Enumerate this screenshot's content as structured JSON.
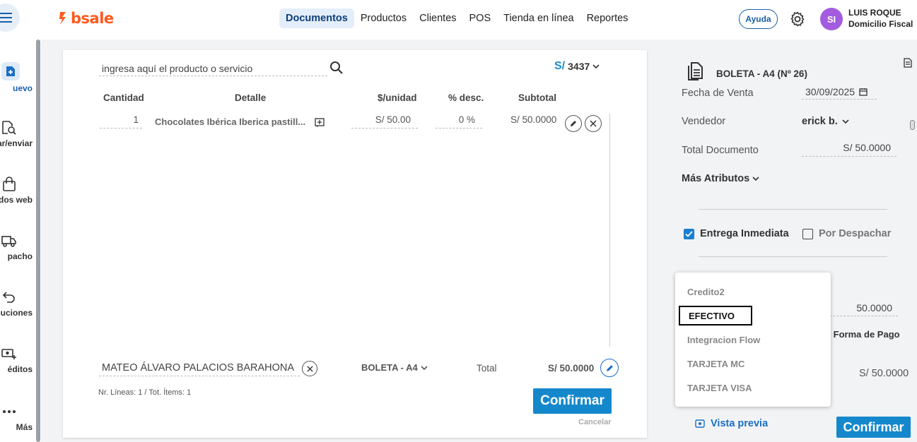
{
  "header": {
    "logo_text": "bsale",
    "nav": [
      "Documentos",
      "Productos",
      "Clientes",
      "POS",
      "Tienda en línea",
      "Reportes"
    ],
    "help_label": "Ayuda",
    "avatar_initials": "SI",
    "user_name": "LUIS ROQUE",
    "user_branch": "Domicilio Fiscal"
  },
  "sidebar": {
    "items": [
      {
        "label": "uevo",
        "icon": "new-document-icon"
      },
      {
        "label": "ar/enviar",
        "icon": "search-document-icon"
      },
      {
        "label": "dos web",
        "icon": "shopping-bag-icon"
      },
      {
        "label": "pacho",
        "icon": "truck-icon"
      },
      {
        "label": "luciones",
        "icon": "return-arrow-icon"
      },
      {
        "label": "éditos",
        "icon": "cash-plus-icon"
      },
      {
        "label": "Más",
        "icon": "more-dots-icon"
      }
    ]
  },
  "document": {
    "search_placeholder": "ingresa aquí el producto o servicio",
    "price_list_currency": "S/",
    "price_list_number": "3437",
    "columns": [
      "Cantidad",
      "Detalle",
      "$/unidad",
      "% desc.",
      "Subtotal"
    ],
    "rows": [
      {
        "quantity": "1",
        "detail": "Chocolates Ibérica Iberica pastill...",
        "unit_price": "S/ 50.00",
        "discount": "0 %",
        "subtotal": "S/ 50.0000"
      }
    ],
    "client": "MATEO ÁLVARO PALACIOS BARAHONA",
    "doc_type": "BOLETA - A4",
    "total_label": "Total",
    "total_value": "S/ 50.0000",
    "lines_info": "Nr. Líneas: 1 / Tot. Ítems: 1",
    "confirm_label": "Confirmar",
    "cancel_label": "Cancelar"
  },
  "side_panel": {
    "doc_title": "BOLETA - A4 (Nº 26)",
    "sale_date_label": "Fecha de Venta",
    "sale_date": "30/09/2025",
    "seller_label": "Vendedor",
    "seller": "erick b.",
    "total_doc_label": "Total Documento",
    "total_doc": "S/ 50.0000",
    "more_attrs": "Más Atributos",
    "delivery_now": "Entrega Inmediata",
    "delivery_now_checked": true,
    "to_dispatch": "Por Despachar",
    "to_dispatch_checked": false,
    "payment_amount": "50.0000",
    "payment_link_partial": "r Forma de Pago",
    "payment_total": "S/ 50.0000",
    "preview_label": "Vista previa",
    "confirm_label": "Confirmar"
  },
  "payment_dropdown": {
    "options": [
      "Credito2",
      "EFECTIVO",
      "Integracion Flow",
      "TARJETA MC",
      "TARJETA VISA"
    ],
    "selected": "EFECTIVO"
  },
  "colors": {
    "brand": "#ff5a1f",
    "primary": "#1588cc",
    "nav_active_bg": "#e4eefa",
    "avatar": "#a35be0"
  }
}
